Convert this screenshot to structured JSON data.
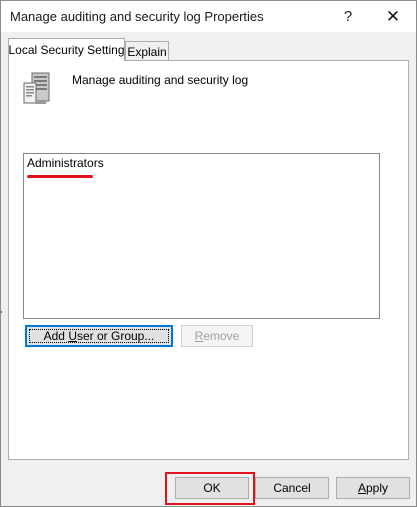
{
  "window": {
    "title": "Manage auditing and security log Properties",
    "help_glyph": "?",
    "close_glyph": "✕"
  },
  "tabs": [
    {
      "label": "Local Security Setting",
      "selected": true
    },
    {
      "label": "Explain",
      "selected": false
    }
  ],
  "policy": {
    "name": "Manage auditing and security log",
    "icon": "server-policy-icon"
  },
  "members_list": {
    "items": [
      "Administrators"
    ],
    "annotation_color": "#e0141e"
  },
  "member_buttons": {
    "add": {
      "label_prefix": "Add ",
      "label_accel": "U",
      "label_suffix": "ser or Group...",
      "enabled": true
    },
    "remove": {
      "label_accel": "R",
      "label_suffix": "emove",
      "enabled": false
    }
  },
  "dialog_buttons": {
    "ok": "OK",
    "cancel": "Cancel",
    "apply_accel": "A",
    "apply_suffix": "pply",
    "highlight_color": "#e0141e"
  }
}
